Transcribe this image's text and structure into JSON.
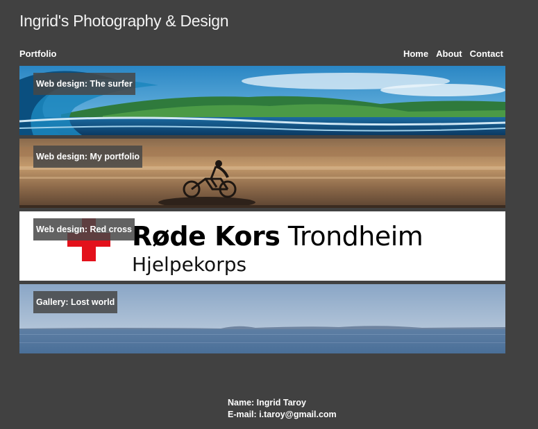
{
  "header": {
    "site_title": "Ingrid's Photography & Design",
    "section_label": "Portfolio",
    "nav": [
      "Home",
      "About",
      "Contact"
    ]
  },
  "portfolio": [
    {
      "caption": "Web design: The surfer",
      "image": "surfer-wave-photo"
    },
    {
      "caption": "Web design: My portfolio",
      "image": "cyclist-beach-photo"
    },
    {
      "caption": "Web design: Red cross",
      "image": "rode-kors-logo",
      "logo_main": "Røde Kors Trondheim",
      "logo_sub": "Hjelpekorps",
      "logo_color": "#e3111b"
    },
    {
      "caption": "Gallery: Lost world",
      "image": "ocean-horizon-photo"
    }
  ],
  "footer": {
    "name": "Name: Ingrid Taroy",
    "email": "E-mail: i.taroy@gmail.com"
  },
  "colors": {
    "background": "#414141",
    "text": "#ffffff"
  }
}
